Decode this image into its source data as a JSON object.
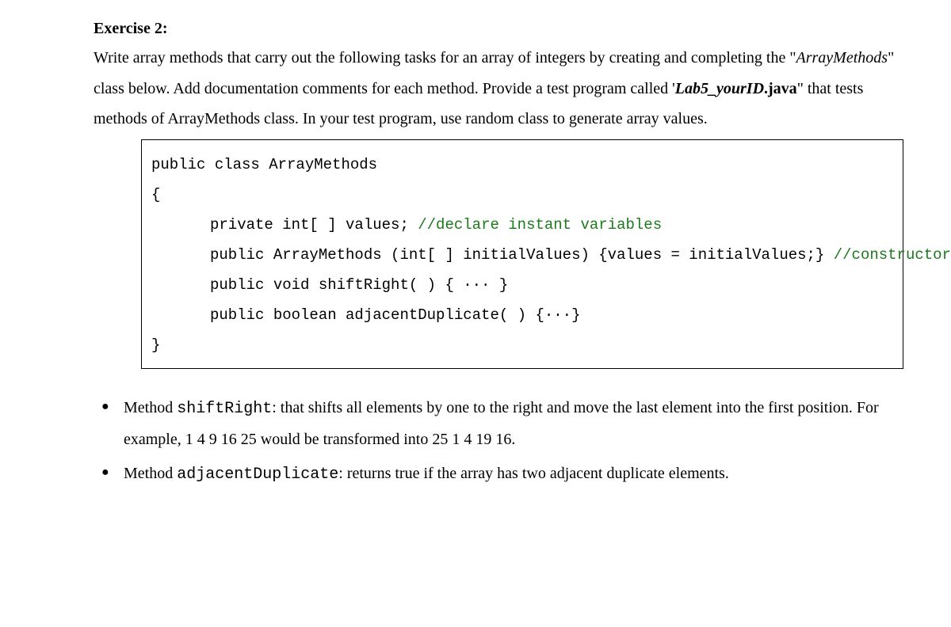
{
  "title": "Exercise 2:",
  "para1_pre": "Write array methods that carry out the following tasks for an array of integers by creating and completing the \"",
  "para1_italic": "ArrayMethods",
  "para1_post": "\" class below. Add documentation comments for each method. Provide a test program called '",
  "para1_bolditalic": "Lab5_yourID",
  "para1_bold": ".java",
  "para1_end": "\" that tests methods of ArrayMethods class. In your test program, use random class to generate array values.",
  "code": {
    "l1": "public class ArrayMethods",
    "l2": "{",
    "l3a": "private int[ ] values; ",
    "l3b": "//declare instant variables",
    "l4a": "public ArrayMethods (int[ ] initialValues) {values = initialValues;} ",
    "l4b": "//constructor",
    "l5": "public void shiftRight( ) { ··· }",
    "l6": "public boolean adjacentDuplicate( ) {···}",
    "l7": "}"
  },
  "bullets": [
    {
      "prefix": "Method ",
      "mono": "shiftRight",
      "rest": ":  that shifts all elements by one to the right and move the last element into the first position. For example, 1 4 9 16 25 would be transformed into 25 1 4 19 16."
    },
    {
      "prefix": "Method ",
      "mono": "adjacentDuplicate",
      "rest": ": returns true if the array has two adjacent duplicate elements."
    }
  ]
}
